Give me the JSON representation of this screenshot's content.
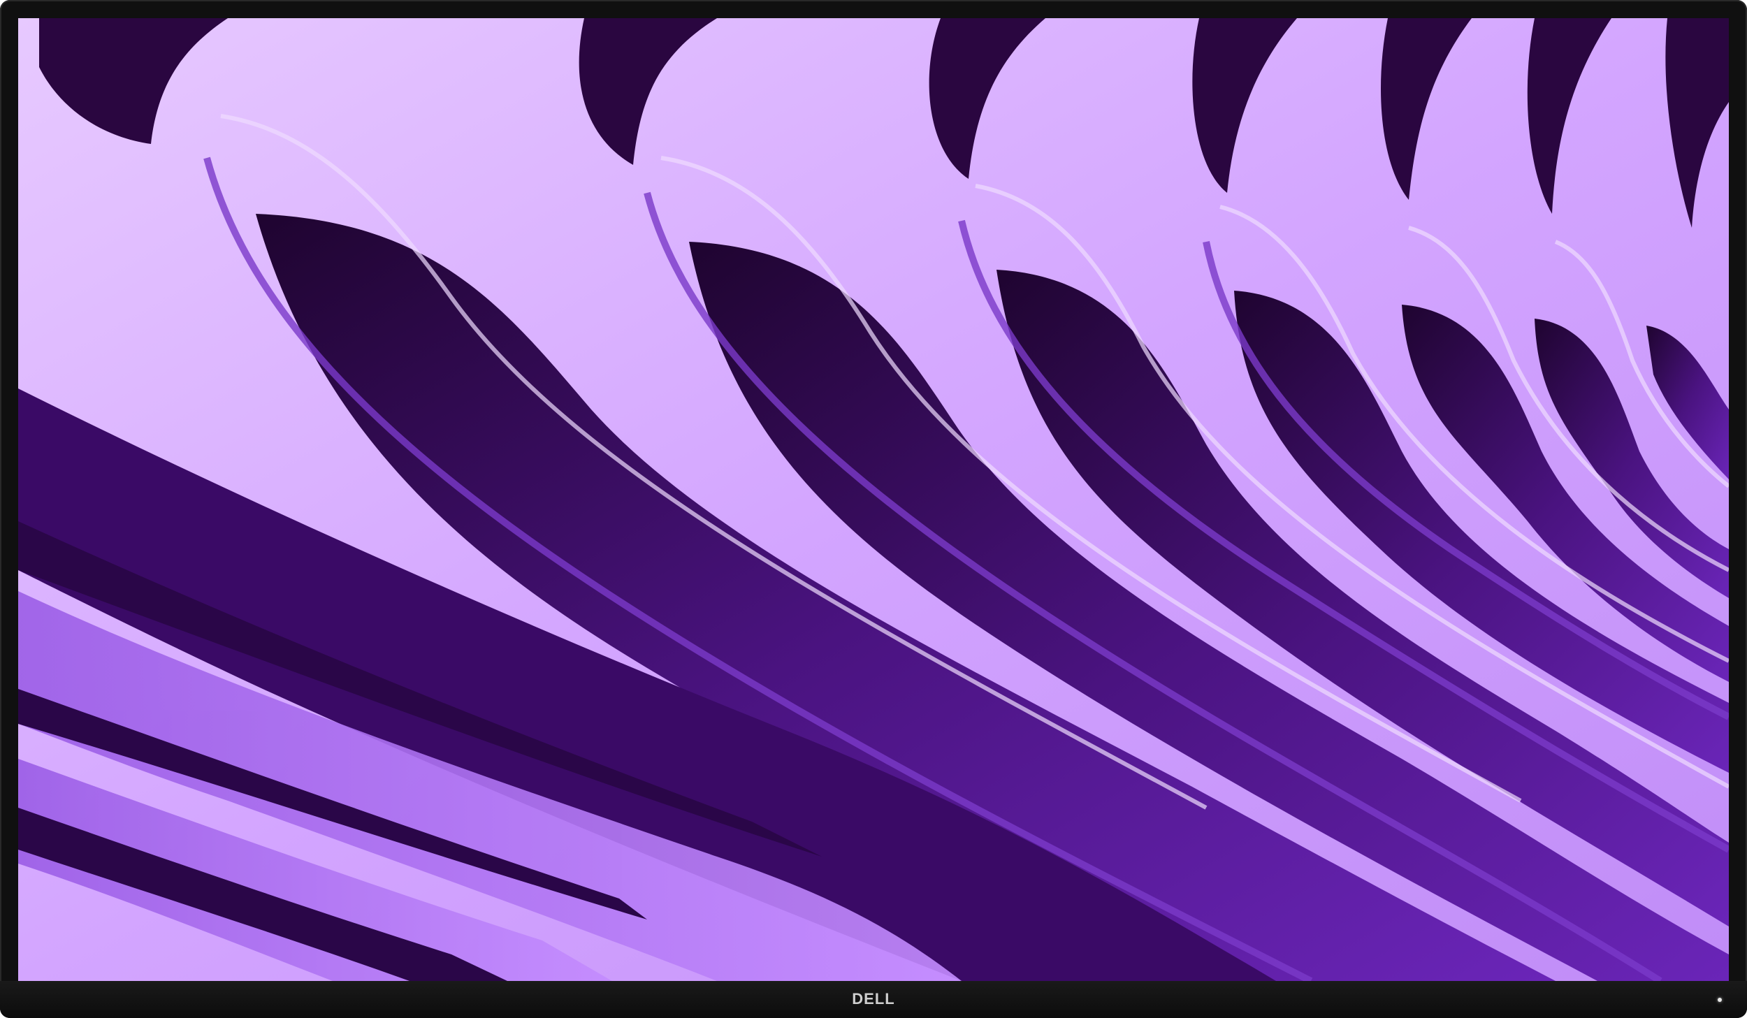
{
  "device": {
    "type": "monitor",
    "brand_logo": "DELL",
    "bezel_color": "#101010"
  },
  "wallpaper": {
    "icon": "abstract-purple-wave-wallpaper",
    "colors": {
      "light": "#e3bfff",
      "mid": "#b57ef5",
      "deep": "#5a1a9e",
      "dark": "#260537"
    }
  },
  "indicators": {
    "power_led_icon": "power-led-indicator"
  }
}
